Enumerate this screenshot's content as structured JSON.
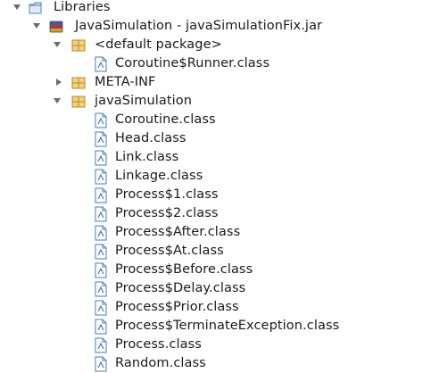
{
  "tree": {
    "libraries": {
      "label": "Libraries",
      "icon": "library-folder-icon"
    },
    "jar": {
      "label": "JavaSimulation - javaSimulationFix.jar",
      "icon": "jar-icon"
    },
    "default_package": {
      "label": "<default package>",
      "icon": "package-icon",
      "children": [
        "Coroutine$Runner.class"
      ]
    },
    "meta_inf": {
      "label": "META-INF",
      "icon": "package-icon"
    },
    "java_simulation": {
      "label": "javaSimulation",
      "icon": "package-icon",
      "children": [
        "Coroutine.class",
        "Head.class",
        "Link.class",
        "Linkage.class",
        "Process$1.class",
        "Process$2.class",
        "Process$After.class",
        "Process$At.class",
        "Process$Before.class",
        "Process$Delay.class",
        "Process$Prior.class",
        "Process$TerminateException.class",
        "Process.class",
        "Random.class"
      ]
    }
  },
  "colors": {
    "package_fill": "#f2d27a",
    "package_stroke": "#b8892a",
    "class_stroke": "#4a78b8",
    "jar_red": "#b5343a",
    "jar_blue": "#3a5ea8"
  }
}
